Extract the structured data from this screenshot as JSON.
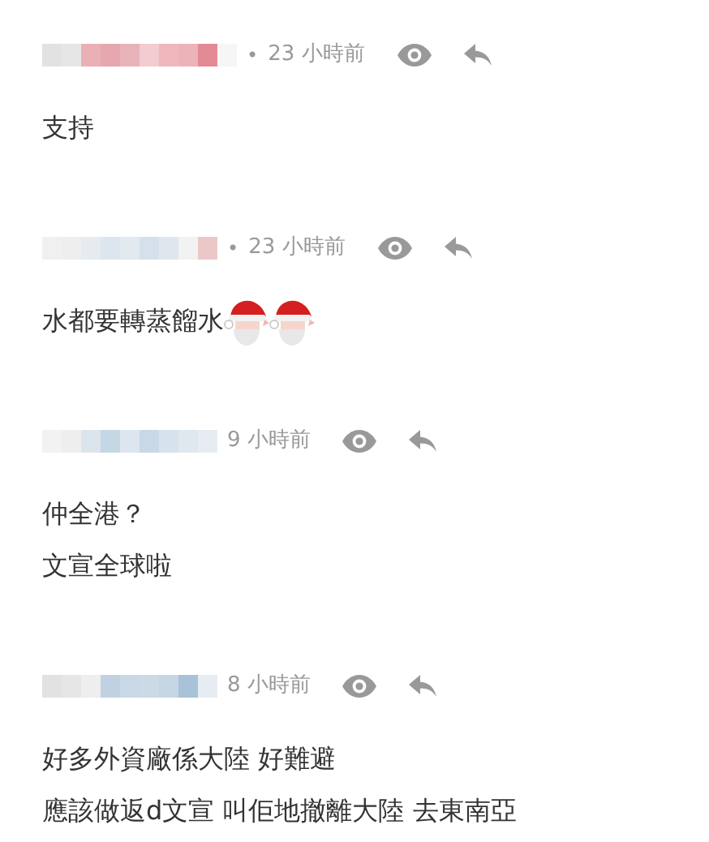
{
  "comments": [
    {
      "separator": "•",
      "time": "23 小時前",
      "lines": [
        "支持"
      ]
    },
    {
      "separator": "•",
      "time": "23 小時前",
      "lines": [
        "水都要轉蒸餾水"
      ],
      "stickers": [
        {
          "kind": "santa"
        },
        {
          "kind": "santa"
        }
      ]
    },
    {
      "time": "9 小時前",
      "lines": [
        "仲全港？",
        "文宣全球啦"
      ]
    },
    {
      "time": "8 小時前",
      "lines": [
        "好多外資廠係大陸 好難避",
        "應該做返d文宣 叫佢地撤離大陸 去東南亞"
      ]
    }
  ]
}
